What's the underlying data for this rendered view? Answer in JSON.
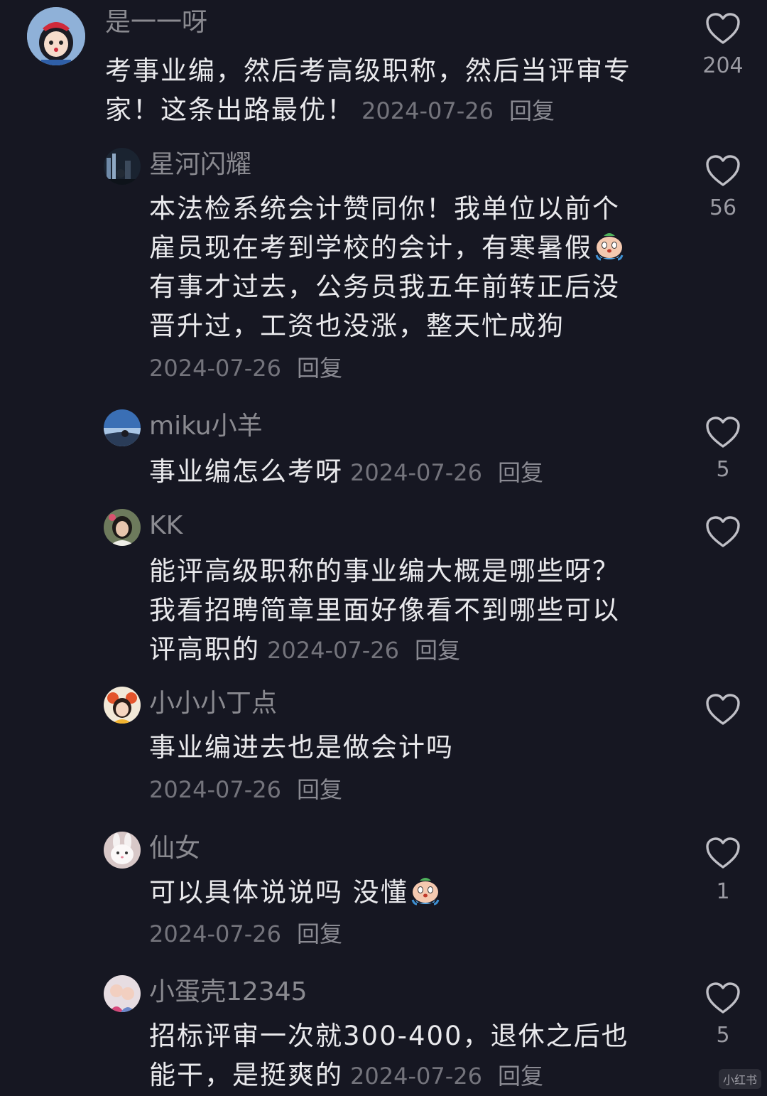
{
  "colors": {
    "background": "#161722",
    "text": "#e9e9ec",
    "muted": "#74747c",
    "heart": "#bfbfc6"
  },
  "reply_label": "回复",
  "watermark": "小红书",
  "comments": [
    {
      "username": "是一一呀",
      "text": "考事业编，然后考高级职称，然后当评审专家！这条出路最优！",
      "date": "2024-07-26",
      "likes": "204",
      "avatar_icon": "snow-white-avatar-icon"
    },
    {
      "username": "星河闪耀",
      "text_lines": [
        "本法检系统会计赞同你！我单位以前个",
        "雇员现在考到学校的会计，有寒暑假",
        "有事才过去，公务员我五年前转正后没",
        "晋升过，工资也没涨，整天忙成狗"
      ],
      "date": "2024-07-26",
      "likes": "56",
      "avatar_icon": "city-night-avatar-icon",
      "emoji": "crying-face-emoji-icon"
    },
    {
      "username": "miku小羊",
      "text": "事业编怎么考呀",
      "date": "2024-07-26",
      "likes": "5",
      "avatar_icon": "sky-avatar-icon"
    },
    {
      "username": "KK",
      "text_lines": [
        "能评高级职称的事业编大概是哪些呀？",
        "我看招聘简章里面好像看不到哪些可以",
        "评高职的"
      ],
      "date": "2024-07-26",
      "likes": "",
      "avatar_icon": "girl-photo-avatar-icon"
    },
    {
      "username": "小小小丁点",
      "text": "事业编进去也是做会计吗",
      "date": "2024-07-26",
      "likes": "",
      "avatar_icon": "cartoon-girl-avatar-icon"
    },
    {
      "username": "仙女",
      "text": "可以具体说说吗 没懂",
      "date": "2024-07-26",
      "likes": "1",
      "avatar_icon": "bunny-avatar-icon",
      "emoji": "crying-face-emoji-icon"
    },
    {
      "username": "小蛋壳12345",
      "text_lines": [
        "招标评审一次就300-400，退休之后也",
        "能干，是挺爽的"
      ],
      "date": "2024-07-26",
      "likes": "5",
      "avatar_icon": "kids-photo-avatar-icon"
    }
  ]
}
